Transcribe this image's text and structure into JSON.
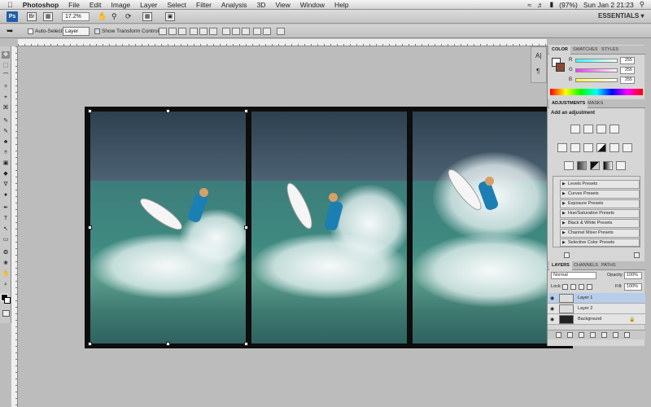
{
  "menubar": {
    "app": "Photoshop",
    "items": [
      "File",
      "Edit",
      "Image",
      "Layer",
      "Select",
      "Filter",
      "Analysis",
      "3D",
      "View",
      "Window",
      "Help"
    ],
    "status": {
      "battery": "(97%)",
      "datetime": "Sun Jan 2  21:23"
    }
  },
  "appbar": {
    "zoom": "17.2%",
    "workspace": "ESSENTIALS ▾"
  },
  "options": {
    "auto_select_label": "Auto-Select:",
    "auto_select_value": "Layer",
    "show_transform_label": "Show Transform Controls"
  },
  "tools": [
    "✥",
    "⬚",
    "⌒",
    "✧",
    "⌖",
    "⌘",
    "✎",
    "✎",
    "♣",
    "⌾",
    "▣",
    "◆",
    "∇",
    "●",
    "✒",
    "T",
    "↖",
    "▭",
    "❂",
    "❀",
    "✋",
    "⌕"
  ],
  "panels": {
    "color": {
      "tabs": [
        "COLOR",
        "SWATCHES",
        "STYLES"
      ],
      "channels": [
        {
          "label": "R",
          "value": "255",
          "color": "#e33"
        },
        {
          "label": "G",
          "value": "255",
          "color": "#3b3"
        },
        {
          "label": "B",
          "value": "255",
          "color": "#36d"
        }
      ]
    },
    "adjustments": {
      "tabs": [
        "ADJUSTMENTS",
        "MASKS"
      ],
      "title": "Add an adjustment",
      "presets": [
        "Levels Presets",
        "Curves Presets",
        "Exposure Presets",
        "Hue/Saturation Presets",
        "Black & White Presets",
        "Channel Mixer Presets",
        "Selective Color Presets"
      ]
    },
    "layers": {
      "tabs": [
        "LAYERS",
        "CHANNELS",
        "PATHS"
      ],
      "blend": "Normal",
      "opacity_label": "Opacity:",
      "opacity": "100%",
      "lock_label": "Lock:",
      "fill_label": "Fill:",
      "fill": "100%",
      "items": [
        {
          "name": "Layer 1",
          "selected": true
        },
        {
          "name": "Layer 2",
          "selected": false
        },
        {
          "name": "Background",
          "selected": false
        }
      ]
    }
  }
}
